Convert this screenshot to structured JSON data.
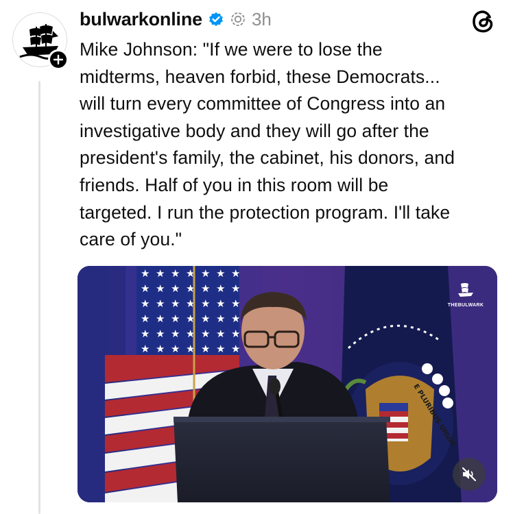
{
  "post": {
    "username": "bulwarkonline",
    "timestamp": "3h",
    "text": "Mike Johnson: \"If we were to lose the\nmidterms, heaven forbid, these Democrats...\nwill turn every committee of Congress into an\ninvestigative body and they will go after the\npresident's family, the cabinet, his donors, and\nfriends. Half of you in this room will be\ntargeted. I run the protection program. I'll take\ncare of you.\""
  },
  "video": {
    "watermark": "THEBULWARK",
    "seal_motto": "E PLURIBUS UNUM"
  },
  "icons": {
    "verified": "verified-badge-icon",
    "ai": "ai-label-icon",
    "threads": "threads-logo-icon",
    "follow": "plus-icon",
    "mute": "speaker-muted-icon"
  },
  "colors": {
    "verified_blue": "#0095f6",
    "text": "#0f0f0f",
    "muted_gray": "#8e8e8e",
    "thread_line": "#e3e3e3"
  }
}
